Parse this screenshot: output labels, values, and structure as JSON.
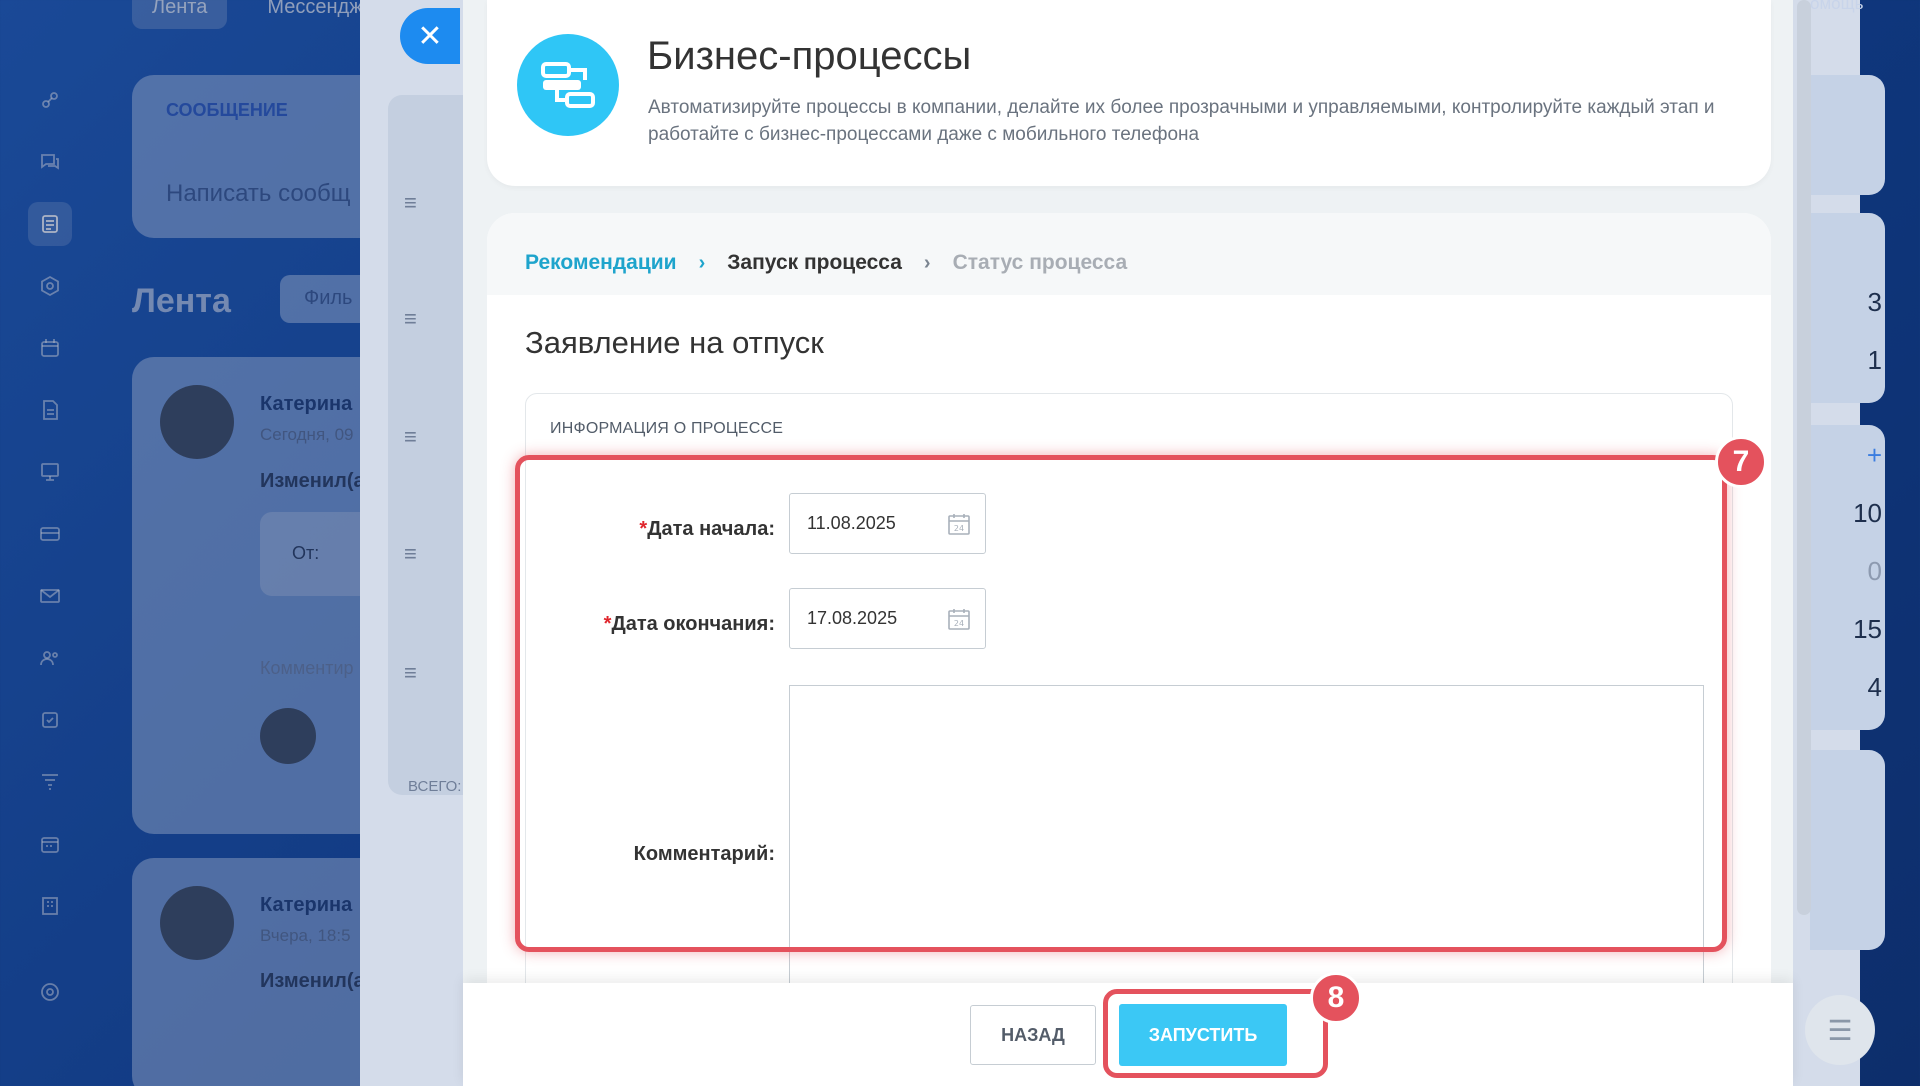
{
  "background": {
    "top_tabs": [
      "Лента",
      "Мессендже"
    ],
    "compose": {
      "tab": "СООБЩЕНИЕ",
      "placeholder": "Написать сообщ"
    },
    "feed_title": "Лента",
    "filter_label": "Филь",
    "posts": [
      {
        "author": "Катерина",
        "time": "Сегодня, 09",
        "action": "Изменил(а",
        "from_label": "От:",
        "comment_label": "Комментир"
      },
      {
        "author": "Катерина",
        "time": "Вчера, 18:5",
        "action": "Изменил(а"
      }
    ],
    "under_slider_footer": "ВСЕГО:",
    "right_counters": [
      "3",
      "1",
      "+",
      "10",
      "0",
      "15",
      "4"
    ],
    "help_label": "омощь"
  },
  "header": {
    "title": "Бизнес-процессы",
    "description": "Автоматизируйте процессы в компании, делайте их более прозрачными и управляемыми, контролируйте каждый этап и работайте с бизнес-процессами даже с мобильного телефона",
    "logo_icon": "business-process-icon"
  },
  "breadcrumb": {
    "items": [
      {
        "label": "Рекомендации",
        "state": "link"
      },
      {
        "label": "Запуск процесса",
        "state": "current"
      },
      {
        "label": "Статус процесса",
        "state": "disabled"
      }
    ]
  },
  "form": {
    "title": "Заявление на отпуск",
    "section_title": "ИНФОРМАЦИЯ О ПРОЦЕССЕ",
    "fields": {
      "start_date": {
        "required_mark": "*",
        "label": "Дата начала:",
        "value": "11.08.2025"
      },
      "end_date": {
        "required_mark": "*",
        "label": "Дата окончания:",
        "value": "17.08.2025"
      },
      "comment": {
        "label": "Комментарий:",
        "value": ""
      }
    }
  },
  "footer": {
    "back_label": "НАЗАД",
    "run_label": "ЗАПУСТИТЬ"
  },
  "annotations": {
    "step_7": "7",
    "step_8": "8"
  },
  "colors": {
    "accent": "#2fc6f6",
    "link": "#1ea4cc",
    "run_button": "#3bc8f5",
    "highlight": "#e4525d"
  }
}
